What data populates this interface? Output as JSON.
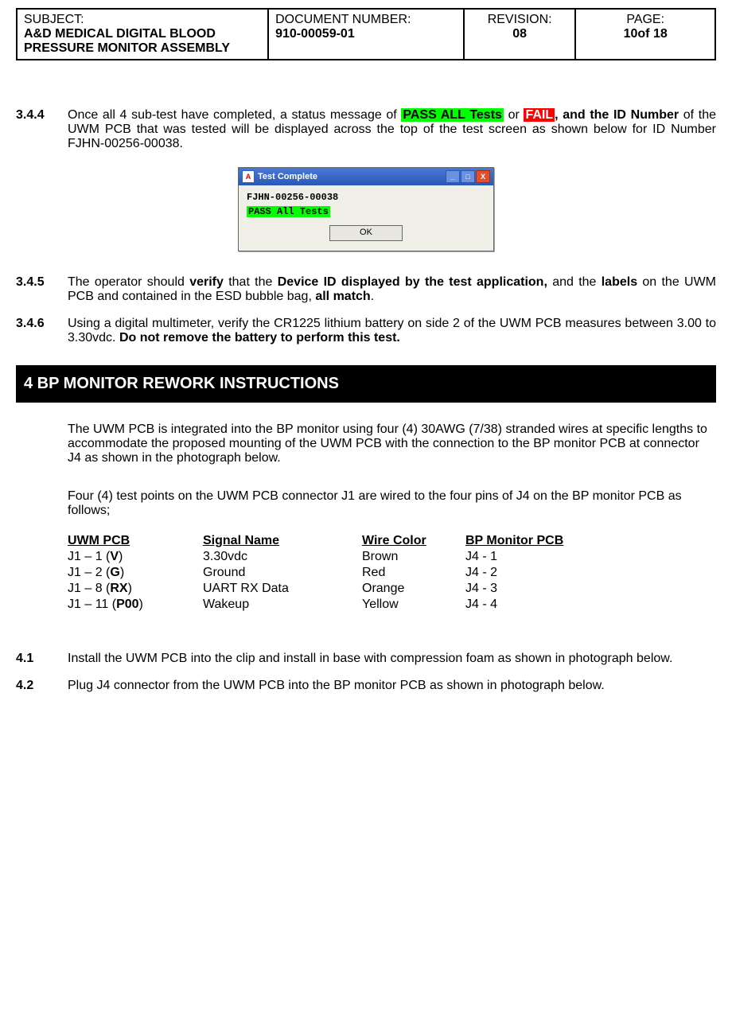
{
  "header": {
    "subject_label": "SUBJECT:",
    "subject_value": "A&D MEDICAL DIGITAL BLOOD PRESSURE MONITOR ASSEMBLY",
    "docnum_label": "DOCUMENT NUMBER:",
    "docnum_value": "910-00059-01",
    "rev_label": "REVISION:",
    "rev_value": "08",
    "page_label": "PAGE:",
    "page_value": "10of 18"
  },
  "s344": {
    "num": "3.4.4",
    "t1": "Once all 4 sub-test have completed, a status message of ",
    "pass": "PASS ALL Tests",
    "t2": "  or ",
    "fail": "FAIL",
    "t3": ", and the ",
    "idnum": "ID Number",
    "t4": " of the UWM PCB that was tested will be displayed across the top of the test screen as shown below for ID Number FJHN-00256-00038."
  },
  "dialog": {
    "title": "Test Complete",
    "icon": "A",
    "min": "_",
    "max": "□",
    "close": "X",
    "line1": "FJHN-00256-00038",
    "line2": "PASS All Tests",
    "ok": "OK"
  },
  "s345": {
    "num": "3.4.5",
    "t1": "The operator should ",
    "verify": "verify",
    "t2": " that the ",
    "devid": "Device ID displayed by the test application,",
    "t3": " and the ",
    "labels": "labels",
    "t4": " on the UWM PCB and contained in the  ESD bubble bag, ",
    "match": "all match",
    "t5": "."
  },
  "s346": {
    "num": "3.4.6",
    "t1": "Using a digital multimeter, verify the CR1225 lithium battery on side 2 of the UWM PCB measures between 3.00 to 3.30vdc. ",
    "bold": "Do not remove the battery to perform this test."
  },
  "section4": {
    "title": "4     BP MONITOR REWORK INSTRUCTIONS",
    "p1": "The UWM PCB is integrated into the BP monitor using four (4) 30AWG (7/38) stranded wires at specific lengths to accommodate the proposed mounting of the UWM   PCB with the connection to the BP monitor PCB at connector J4 as shown in the photograph below.",
    "p2": "Four (4) test points on the UWM PCB connector J1 are wired to the four pins of J4 on the BP monitor PCB as follows;"
  },
  "pins": {
    "h1": "UWM PCB",
    "h2": "Signal  Name",
    "h3": "Wire Color",
    "h4": "BP Monitor PCB",
    "r1c1a": "J1 – 1 (",
    "r1c1b": "V",
    "r1c1c": ")",
    "r1c2": "3.30vdc",
    "r1c3": "Brown",
    "r1c4": "J4 - 1",
    "r2c1a": "J1 – 2 (",
    "r2c1b": "G",
    "r2c1c": ")",
    "r2c2": "Ground",
    "r2c3": "Red",
    "r2c4": "J4 - 2",
    "r3c1a": "J1 – 8 (",
    "r3c1b": "RX",
    "r3c1c": ")",
    "r3c2": "UART RX Data",
    "r3c3": "Orange",
    "r3c4": "J4 - 3",
    "r4c1a": "J1 – 11 (",
    "r4c1b": "P00",
    "r4c1c": ")",
    "r4c2": "Wakeup",
    "r4c3": "Yellow",
    "r4c4": "J4 - 4"
  },
  "s41": {
    "num": "4.1",
    "t": "Install the UWM PCB into the clip and install in base with compression foam as shown in photograph below."
  },
  "s42": {
    "num": "4.2",
    "t": "Plug J4 connector from the UWM PCB into the BP monitor PCB as shown in photograph below."
  }
}
